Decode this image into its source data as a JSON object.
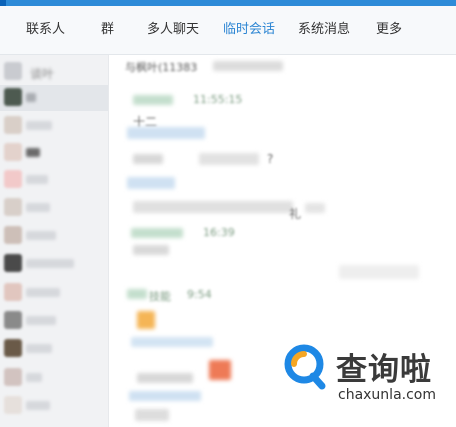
{
  "tabs": [
    {
      "label": "联系人",
      "active": false
    },
    {
      "label": "群",
      "active": false
    },
    {
      "label": "多人聊天",
      "active": false
    },
    {
      "label": "临时会话",
      "active": true
    },
    {
      "label": "系统消息",
      "active": false
    },
    {
      "label": "更多",
      "active": false
    }
  ],
  "sidebar": {
    "first_item_label": "谈叶"
  },
  "chat": {
    "title": "与枫叶(11383",
    "messages": [
      {
        "time": "11:55:15",
        "text": "十二"
      },
      {
        "time": "16:39",
        "text": "?"
      },
      {
        "time": "9:54",
        "text": "技能"
      }
    ],
    "fragment_text": "礼"
  },
  "watermark": {
    "name": "查询啦",
    "url": "chaxunla.com"
  },
  "colors": {
    "accent": "#2d86d3",
    "topbar": "#2d8bd8",
    "watermark_orange": "#f5a623",
    "watermark_blue": "#1e88e5"
  }
}
